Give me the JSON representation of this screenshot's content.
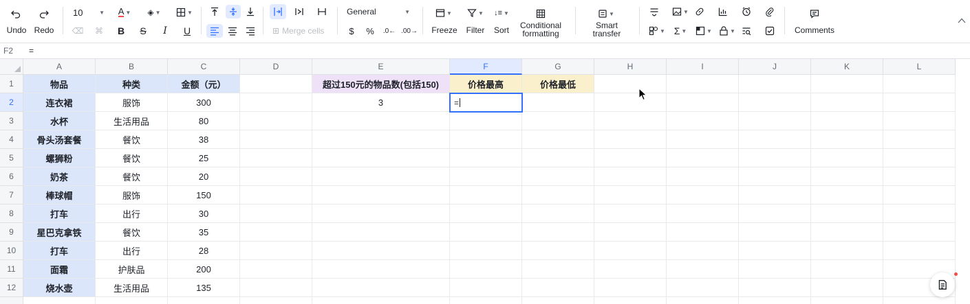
{
  "toolbar": {
    "undo_label": "Undo",
    "redo_label": "Redo",
    "font_size": "10",
    "merge_cells_label": "Merge cells",
    "number_format": "General",
    "currency_symbol": "$",
    "percent_symbol": "%",
    "freeze_label": "Freeze",
    "filter_label": "Filter",
    "sort_label": "Sort",
    "conditional_line1": "Conditional",
    "conditional_line2": "formatting",
    "smart_line1": "Smart",
    "smart_line2": "transfer",
    "comments_label": "Comments",
    "accent_color": "#3370ff",
    "font_color": "#f54a45"
  },
  "formula_bar": {
    "cell_ref": "F2",
    "content": "="
  },
  "columns": [
    "A",
    "B",
    "C",
    "D",
    "E",
    "F",
    "G",
    "H",
    "I",
    "J",
    "K",
    "L"
  ],
  "rows": [
    "1",
    "2",
    "3",
    "4",
    "5",
    "6",
    "7",
    "8",
    "9",
    "10",
    "11",
    "12"
  ],
  "table": {
    "headers": [
      "物品",
      "种类",
      "金额（元）"
    ],
    "rows": [
      [
        "连衣裙",
        "服饰",
        "300"
      ],
      [
        "水杯",
        "生活用品",
        "80"
      ],
      [
        "骨头汤套餐",
        "餐饮",
        "38"
      ],
      [
        "螺狮粉",
        "餐饮",
        "25"
      ],
      [
        "奶茶",
        "餐饮",
        "20"
      ],
      [
        "棒球帽",
        "服饰",
        "150"
      ],
      [
        "打车",
        "出行",
        "30"
      ],
      [
        "星巴克拿铁",
        "餐饮",
        "35"
      ],
      [
        "打车",
        "出行",
        "28"
      ],
      [
        "面霜",
        "护肤品",
        "200"
      ],
      [
        "烧水壶",
        "生活用品",
        "135"
      ]
    ]
  },
  "summary": {
    "e1": "超过150元的物品数(包括150)",
    "e2": "3",
    "f1": "价格最高",
    "g1": "价格最低",
    "f2_editing": "="
  }
}
